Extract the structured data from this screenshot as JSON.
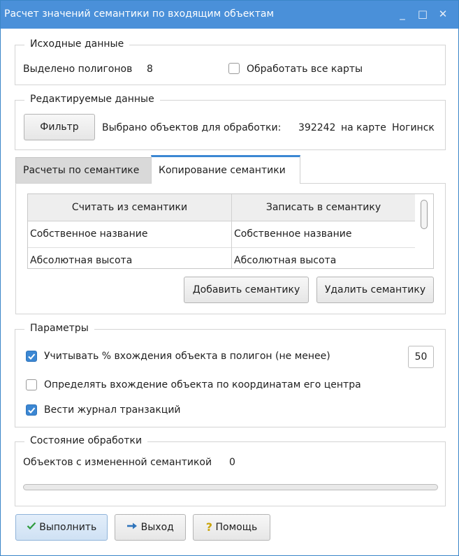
{
  "window": {
    "title": "Расчет значений семантики по входящим объектам",
    "controls": {
      "minimize": "_",
      "maximize": "□",
      "close": "✕"
    }
  },
  "source": {
    "legend": "Исходные данные",
    "polygons_label": "Выделено полигонов",
    "polygons_count": "8",
    "all_maps_label": "Обработать все карты",
    "all_maps_checked": false
  },
  "edited": {
    "legend": "Редактируемые данные",
    "filter_button": "Фильтр",
    "selected_label": "Выбрано объектов для обработки:",
    "selected_count": "392242",
    "on_map_label": "на карте",
    "map_name": "Ногинск"
  },
  "tabs": [
    {
      "label": "Расчеты по семантике",
      "active": false
    },
    {
      "label": "Копирование семантики",
      "active": true
    }
  ],
  "copy_table": {
    "columns": [
      "Считать из семантики",
      "Записать в семантику"
    ],
    "rows": [
      [
        "Собственное название",
        "Собственное название"
      ],
      [
        "Абсолютная высота",
        "Абсолютная высота"
      ]
    ],
    "add_button": "Добавить семантику",
    "remove_button": "Удалить семантику"
  },
  "params": {
    "legend": "Параметры",
    "options": [
      {
        "label": "Учитывать % вхождения объекта в полигон (не менее)",
        "checked": true
      },
      {
        "label": "Определять вхождение объекта по координатам его центра",
        "checked": false
      },
      {
        "label": "Вести журнал транзакций",
        "checked": true
      }
    ],
    "percent_value": "50"
  },
  "status": {
    "legend": "Состояние обработки",
    "changed_label": "Объектов с измененной семантикой",
    "changed_count": "0",
    "progress": 0
  },
  "footer": {
    "run_button": "Выполнить",
    "exit_button": "Выход",
    "help_button": "Помощь"
  },
  "colors": {
    "titlebar": "#4a90d9",
    "accent": "#3b87d3",
    "run_icon": "#2e9b3e",
    "help_icon": "#c9a40a"
  }
}
